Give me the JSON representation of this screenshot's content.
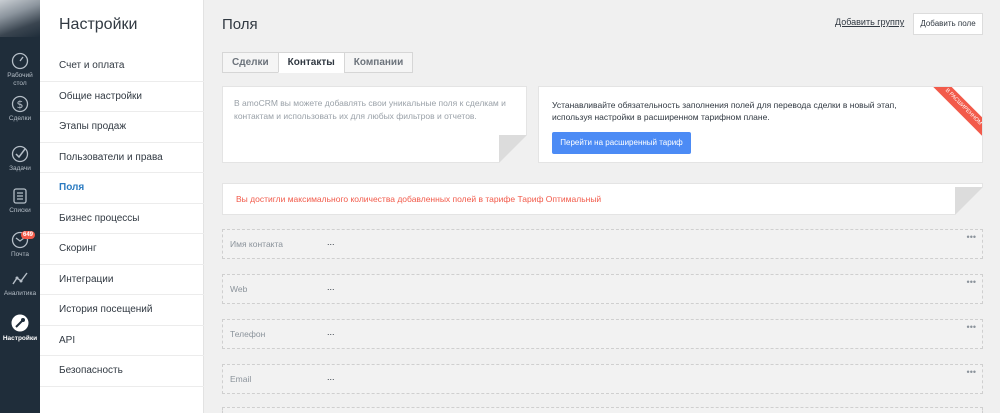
{
  "nav": {
    "items": [
      {
        "label": "Рабочий стол",
        "icon": "dashboard-icon"
      },
      {
        "label": "Сделки",
        "icon": "dollar-icon"
      },
      {
        "label": "Задачи",
        "icon": "check-icon"
      },
      {
        "label": "Списки",
        "icon": "list-icon"
      },
      {
        "label": "Почта",
        "icon": "mail-icon",
        "badge": "649"
      },
      {
        "label": "Аналитика",
        "icon": "analytics-icon"
      },
      {
        "label": "Настройки",
        "icon": "settings-icon"
      }
    ]
  },
  "sidebar": {
    "title": "Настройки",
    "items": [
      {
        "label": "Счет и оплата"
      },
      {
        "label": "Общие настройки"
      },
      {
        "label": "Этапы продаж"
      },
      {
        "label": "Пользователи и права"
      },
      {
        "label": "Поля"
      },
      {
        "label": "Бизнес процессы"
      },
      {
        "label": "Скоринг"
      },
      {
        "label": "Интеграции"
      },
      {
        "label": "История посещений"
      },
      {
        "label": "API"
      },
      {
        "label": "Безопасность"
      }
    ],
    "active_index": 4
  },
  "main": {
    "title": "Поля",
    "add_group_label": "Добавить группу",
    "add_field_label": "Добавить поле",
    "tabs": [
      {
        "label": "Сделки"
      },
      {
        "label": "Контакты"
      },
      {
        "label": "Компании"
      }
    ],
    "active_tab": 1,
    "info_text": "В amoCRM вы можете добавлять свои уникальные поля к сделкам и контактам и использовать их для любых фильтров и отчетов.",
    "upgrade_text": "Устанавливайте обязательность заполнения полей для перевода сделки в новый этап, используя настройки в расширенном тарифном плане.",
    "upgrade_button": "Перейти на расширенный тариф",
    "ribbon_text": "В РАСШИРЕННОМ",
    "warning_text": "Вы достигли максимального количества добавленных полей в тарифе Тариф Оптимальный",
    "fields": [
      {
        "name": "Имя контакта",
        "value": "...",
        "menu": "•••"
      },
      {
        "name": "Web",
        "value": "...",
        "menu": "•••"
      },
      {
        "name": "Телефон",
        "value": "...",
        "menu": "•••"
      },
      {
        "name": "Email",
        "value": "...",
        "menu": "•••"
      }
    ]
  },
  "colors": {
    "nav_bg": "#1f2d3a",
    "accent": "#2b7bc1",
    "button": "#4c8bf5",
    "warning": "#f25a4a"
  }
}
